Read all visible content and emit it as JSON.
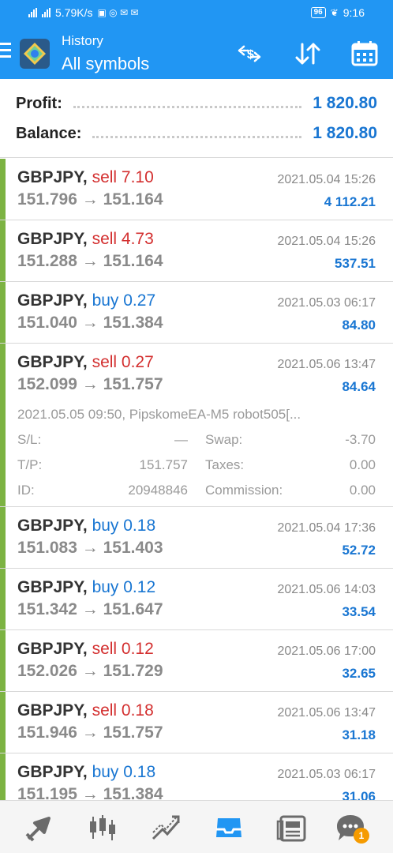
{
  "status_bar": {
    "net_speed": "5.79K/s",
    "battery": "96",
    "time": "9:16"
  },
  "header": {
    "subtitle": "History",
    "title": "All symbols",
    "icons": [
      "currency-exchange-icon",
      "sort-icon",
      "calendar-icon"
    ]
  },
  "summary": {
    "profit_label": "Profit:",
    "profit_value": "1 820.80",
    "balance_label": "Balance:",
    "balance_value": "1 820.80"
  },
  "trades": [
    {
      "symbol": "GBPJPY,",
      "side": "sell 7.10",
      "side_type": "sell",
      "open": "151.796",
      "close": "151.164",
      "arrow": "→",
      "time": "2021.05.04 15:26",
      "profit": "4 112.21"
    },
    {
      "symbol": "GBPJPY,",
      "side": "sell 4.73",
      "side_type": "sell",
      "open": "151.288",
      "close": "151.164",
      "arrow": "→",
      "time": "2021.05.04 15:26",
      "profit": "537.51"
    },
    {
      "symbol": "GBPJPY,",
      "side": "buy 0.27",
      "side_type": "buy",
      "open": "151.040",
      "close": "151.384",
      "arrow": "→",
      "time": "2021.05.03 06:17",
      "profit": "84.80"
    },
    {
      "symbol": "GBPJPY,",
      "side": "sell 0.27",
      "side_type": "sell",
      "open": "152.099",
      "close": "151.757",
      "arrow": "→",
      "time": "2021.05.06 13:47",
      "profit": "84.64",
      "details": {
        "comment": "2021.05.05 09:50, PipskomeEA-M5 robot505[...",
        "sl_label": "S/L:",
        "sl_value": "—",
        "swap_label": "Swap:",
        "swap_value": "-3.70",
        "tp_label": "T/P:",
        "tp_value": "151.757",
        "taxes_label": "Taxes:",
        "taxes_value": "0.00",
        "id_label": "ID:",
        "id_value": "20948846",
        "commission_label": "Commission:",
        "commission_value": "0.00"
      }
    },
    {
      "symbol": "GBPJPY,",
      "side": "buy 0.18",
      "side_type": "buy",
      "open": "151.083",
      "close": "151.403",
      "arrow": "→",
      "time": "2021.05.04 17:36",
      "profit": "52.72"
    },
    {
      "symbol": "GBPJPY,",
      "side": "buy 0.12",
      "side_type": "buy",
      "open": "151.342",
      "close": "151.647",
      "arrow": "→",
      "time": "2021.05.06 14:03",
      "profit": "33.54"
    },
    {
      "symbol": "GBPJPY,",
      "side": "sell 0.12",
      "side_type": "sell",
      "open": "152.026",
      "close": "151.729",
      "arrow": "→",
      "time": "2021.05.06 17:00",
      "profit": "32.65"
    },
    {
      "symbol": "GBPJPY,",
      "side": "sell 0.18",
      "side_type": "sell",
      "open": "151.946",
      "close": "151.757",
      "arrow": "→",
      "time": "2021.05.06 13:47",
      "profit": "31.18"
    },
    {
      "symbol": "GBPJPY,",
      "side": "buy 0.18",
      "side_type": "buy",
      "open": "151.195",
      "close": "151.384",
      "arrow": "→",
      "time": "2021.05.03 06:17",
      "profit": "31.06"
    }
  ],
  "bottom_nav": {
    "items": [
      "quotes-icon",
      "chart-icon",
      "trade-icon",
      "history-icon",
      "news-icon",
      "messages-icon"
    ],
    "active": "history-icon",
    "messages_badge": "1"
  },
  "colors": {
    "accent": "#2196f3",
    "profit_blue": "#1976d2",
    "sell_red": "#d32f2f",
    "trade_bar_green": "#7cb342",
    "badge_orange": "#f59b00"
  }
}
